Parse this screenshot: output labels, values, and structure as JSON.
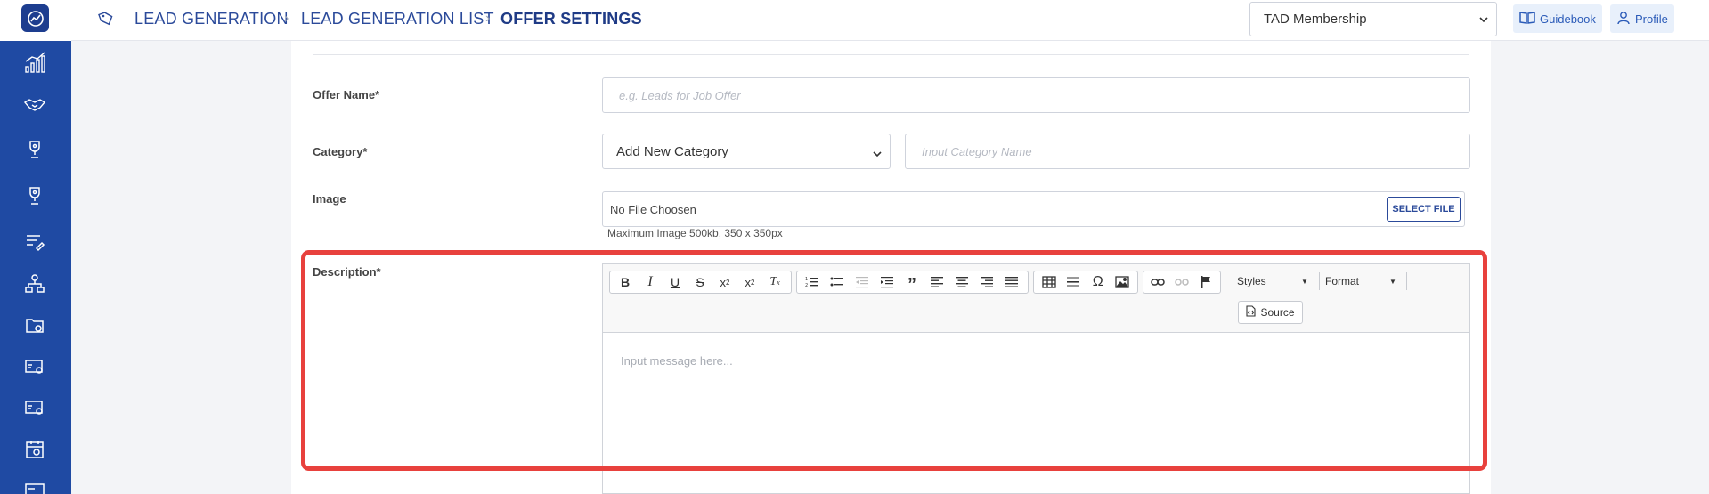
{
  "header": {
    "breadcrumb": [
      "LEAD GENERATION",
      "LEAD GENERATION LIST",
      "OFFER SETTINGS"
    ],
    "membership_select": "TAD Membership",
    "guidebook_label": "Guidebook",
    "profile_label": "Profile"
  },
  "sidebar": {
    "items": [
      "chart-icon",
      "handshake-icon",
      "trophy-icon",
      "trophy-icon",
      "list-edit-icon",
      "hierarchy-icon",
      "folder-clock-icon",
      "card-settings-icon",
      "card-settings-icon",
      "calendar-icon",
      "card-icon"
    ]
  },
  "form": {
    "offer_name_label": "Offer Name*",
    "offer_name_placeholder": "e.g. Leads for Job Offer",
    "category_label": "Category*",
    "category_value": "Add New Category",
    "category_name_placeholder": "Input Category Name",
    "image_label": "Image",
    "file_status": "No File Choosen",
    "select_file_label": "SELECT FILE",
    "image_hint": "Maximum Image 500kb, 350 x 350px",
    "description_label": "Description*"
  },
  "editor": {
    "styles_label": "Styles",
    "format_label": "Format",
    "source_label": "Source",
    "placeholder": "Input message here..."
  },
  "colors": {
    "brand": "#1f4aa3",
    "highlight": "#e8413d",
    "link": "#2b4a9a"
  }
}
